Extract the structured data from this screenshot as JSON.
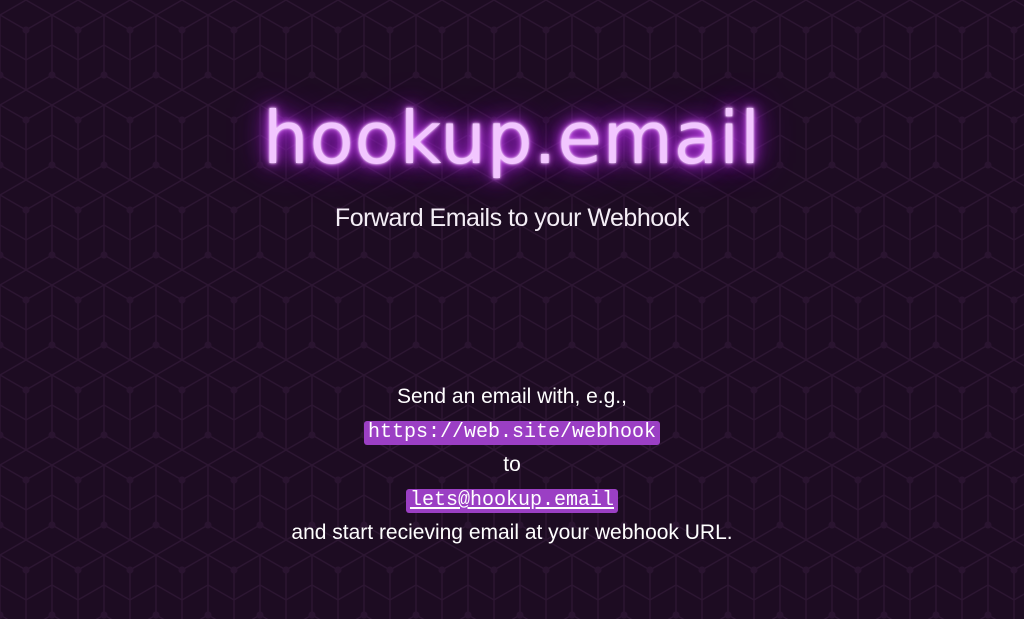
{
  "logo": {
    "text": "hookup.email",
    "glow_color": "#c03cf0"
  },
  "tagline": "Forward Emails to your Webhook",
  "instructions": {
    "line1": "Send an email with, e.g.,",
    "example_url": "https://web.site/webhook",
    "line2": "to",
    "email_address": "lets@hookup.email",
    "line3": "and start recieving email at your webhook URL."
  },
  "colors": {
    "background": "#1d0c22",
    "code_background": "#9b3fc4",
    "text": "#ffffff"
  }
}
